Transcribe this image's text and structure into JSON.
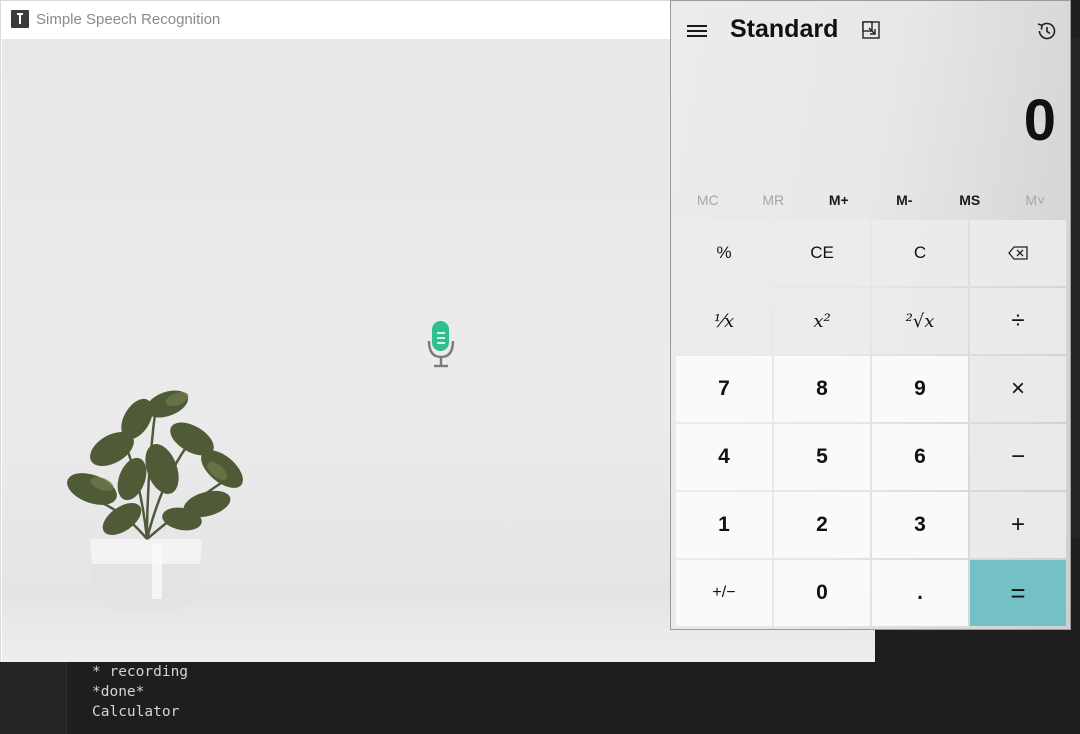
{
  "speech_app": {
    "title": "Simple Speech Recognition",
    "icons": {
      "app": "app-icon",
      "mic": "microphone-icon",
      "plant": "potted-plant-image"
    },
    "colors": {
      "mic_accent": "#2ebf91"
    }
  },
  "terminal": {
    "lines": [
      "* recording",
      "*done*",
      "Calculator"
    ]
  },
  "calculator": {
    "mode": "Standard",
    "display": "0",
    "icons": {
      "menu": "hamburger-menu-icon",
      "keep_on_top": "keep-on-top-icon",
      "history": "history-icon",
      "backspace": "backspace-icon"
    },
    "memory": [
      {
        "label": "MC",
        "enabled": false
      },
      {
        "label": "MR",
        "enabled": false
      },
      {
        "label": "M+",
        "enabled": true
      },
      {
        "label": "M-",
        "enabled": true
      },
      {
        "label": "MS",
        "enabled": true
      },
      {
        "label": "M˅",
        "enabled": false
      }
    ],
    "keys": [
      [
        "%",
        "CE",
        "C",
        "⌫"
      ],
      [
        "⅟x",
        "x²",
        "²√x",
        "÷"
      ],
      [
        "7",
        "8",
        "9",
        "×"
      ],
      [
        "4",
        "5",
        "6",
        "−"
      ],
      [
        "1",
        "2",
        "3",
        "+"
      ],
      [
        "+/−",
        "0",
        ".",
        "="
      ]
    ],
    "colors": {
      "equals_button": "#73c0c6"
    }
  }
}
